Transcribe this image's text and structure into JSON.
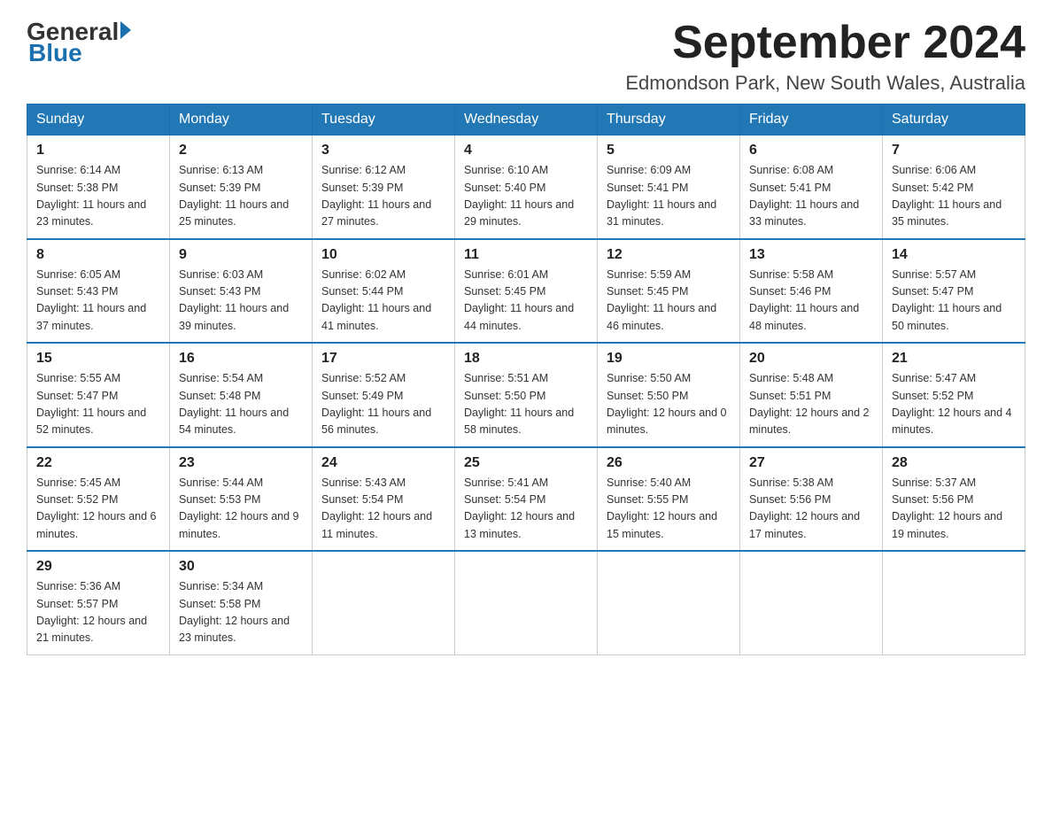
{
  "logo": {
    "general": "General",
    "triangle": "",
    "blue": "Blue"
  },
  "title": {
    "month": "September 2024",
    "location": "Edmondson Park, New South Wales, Australia"
  },
  "weekdays": [
    "Sunday",
    "Monday",
    "Tuesday",
    "Wednesday",
    "Thursday",
    "Friday",
    "Saturday"
  ],
  "weeks": [
    [
      {
        "day": "1",
        "sunrise": "6:14 AM",
        "sunset": "5:38 PM",
        "daylight": "11 hours and 23 minutes."
      },
      {
        "day": "2",
        "sunrise": "6:13 AM",
        "sunset": "5:39 PM",
        "daylight": "11 hours and 25 minutes."
      },
      {
        "day": "3",
        "sunrise": "6:12 AM",
        "sunset": "5:39 PM",
        "daylight": "11 hours and 27 minutes."
      },
      {
        "day": "4",
        "sunrise": "6:10 AM",
        "sunset": "5:40 PM",
        "daylight": "11 hours and 29 minutes."
      },
      {
        "day": "5",
        "sunrise": "6:09 AM",
        "sunset": "5:41 PM",
        "daylight": "11 hours and 31 minutes."
      },
      {
        "day": "6",
        "sunrise": "6:08 AM",
        "sunset": "5:41 PM",
        "daylight": "11 hours and 33 minutes."
      },
      {
        "day": "7",
        "sunrise": "6:06 AM",
        "sunset": "5:42 PM",
        "daylight": "11 hours and 35 minutes."
      }
    ],
    [
      {
        "day": "8",
        "sunrise": "6:05 AM",
        "sunset": "5:43 PM",
        "daylight": "11 hours and 37 minutes."
      },
      {
        "day": "9",
        "sunrise": "6:03 AM",
        "sunset": "5:43 PM",
        "daylight": "11 hours and 39 minutes."
      },
      {
        "day": "10",
        "sunrise": "6:02 AM",
        "sunset": "5:44 PM",
        "daylight": "11 hours and 41 minutes."
      },
      {
        "day": "11",
        "sunrise": "6:01 AM",
        "sunset": "5:45 PM",
        "daylight": "11 hours and 44 minutes."
      },
      {
        "day": "12",
        "sunrise": "5:59 AM",
        "sunset": "5:45 PM",
        "daylight": "11 hours and 46 minutes."
      },
      {
        "day": "13",
        "sunrise": "5:58 AM",
        "sunset": "5:46 PM",
        "daylight": "11 hours and 48 minutes."
      },
      {
        "day": "14",
        "sunrise": "5:57 AM",
        "sunset": "5:47 PM",
        "daylight": "11 hours and 50 minutes."
      }
    ],
    [
      {
        "day": "15",
        "sunrise": "5:55 AM",
        "sunset": "5:47 PM",
        "daylight": "11 hours and 52 minutes."
      },
      {
        "day": "16",
        "sunrise": "5:54 AM",
        "sunset": "5:48 PM",
        "daylight": "11 hours and 54 minutes."
      },
      {
        "day": "17",
        "sunrise": "5:52 AM",
        "sunset": "5:49 PM",
        "daylight": "11 hours and 56 minutes."
      },
      {
        "day": "18",
        "sunrise": "5:51 AM",
        "sunset": "5:50 PM",
        "daylight": "11 hours and 58 minutes."
      },
      {
        "day": "19",
        "sunrise": "5:50 AM",
        "sunset": "5:50 PM",
        "daylight": "12 hours and 0 minutes."
      },
      {
        "day": "20",
        "sunrise": "5:48 AM",
        "sunset": "5:51 PM",
        "daylight": "12 hours and 2 minutes."
      },
      {
        "day": "21",
        "sunrise": "5:47 AM",
        "sunset": "5:52 PM",
        "daylight": "12 hours and 4 minutes."
      }
    ],
    [
      {
        "day": "22",
        "sunrise": "5:45 AM",
        "sunset": "5:52 PM",
        "daylight": "12 hours and 6 minutes."
      },
      {
        "day": "23",
        "sunrise": "5:44 AM",
        "sunset": "5:53 PM",
        "daylight": "12 hours and 9 minutes."
      },
      {
        "day": "24",
        "sunrise": "5:43 AM",
        "sunset": "5:54 PM",
        "daylight": "12 hours and 11 minutes."
      },
      {
        "day": "25",
        "sunrise": "5:41 AM",
        "sunset": "5:54 PM",
        "daylight": "12 hours and 13 minutes."
      },
      {
        "day": "26",
        "sunrise": "5:40 AM",
        "sunset": "5:55 PM",
        "daylight": "12 hours and 15 minutes."
      },
      {
        "day": "27",
        "sunrise": "5:38 AM",
        "sunset": "5:56 PM",
        "daylight": "12 hours and 17 minutes."
      },
      {
        "day": "28",
        "sunrise": "5:37 AM",
        "sunset": "5:56 PM",
        "daylight": "12 hours and 19 minutes."
      }
    ],
    [
      {
        "day": "29",
        "sunrise": "5:36 AM",
        "sunset": "5:57 PM",
        "daylight": "12 hours and 21 minutes."
      },
      {
        "day": "30",
        "sunrise": "5:34 AM",
        "sunset": "5:58 PM",
        "daylight": "12 hours and 23 minutes."
      },
      null,
      null,
      null,
      null,
      null
    ]
  ]
}
